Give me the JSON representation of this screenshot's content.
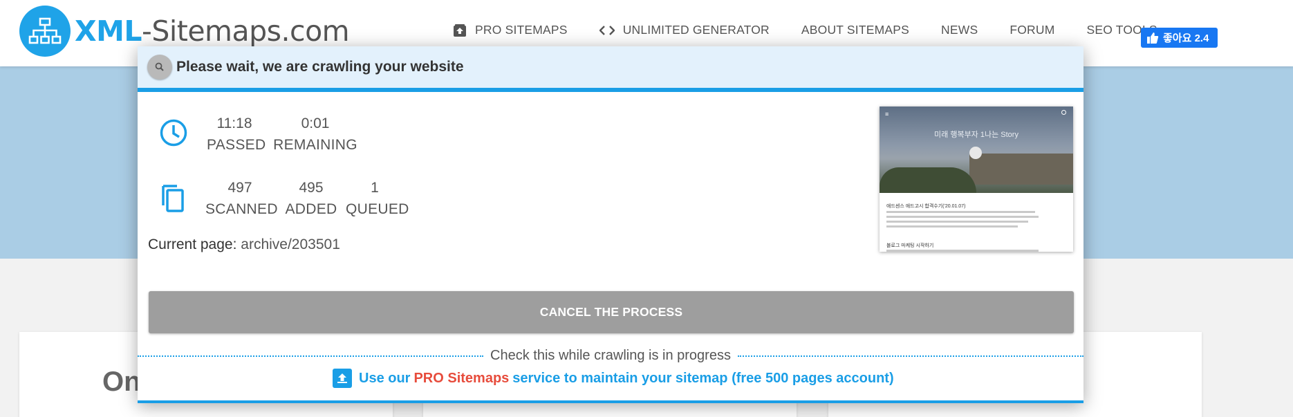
{
  "header": {
    "logo_xml": "XML",
    "logo_rest": "-Sitemaps.com",
    "nav": [
      {
        "label": "PRO SITEMAPS",
        "icon": "pro-sitemaps-icon"
      },
      {
        "label": "UNLIMITED GENERATOR",
        "icon": "code-icon"
      },
      {
        "label": "ABOUT SITEMAPS"
      },
      {
        "label": "NEWS"
      },
      {
        "label": "FORUM"
      },
      {
        "label": "SEO TOOLS"
      }
    ],
    "fb_like_label": "좋아요 2.4"
  },
  "background": {
    "card_title": "On"
  },
  "modal": {
    "title": "Please wait, we are crawling your website",
    "time": {
      "passed_value": "11:18",
      "passed_label": "PASSED",
      "remaining_value": "0:01",
      "remaining_label": "REMAINING"
    },
    "pages": {
      "scanned_value": "497",
      "scanned_label": "SCANNED",
      "added_value": "495",
      "added_label": "ADDED",
      "queued_value": "1",
      "queued_label": "QUEUED"
    },
    "current_label": "Current page:",
    "current_value": "archive/203501",
    "thumbnail": {
      "site_title": "미래 행복부자 1나는 Story",
      "post1_title": "애드센스 애드고시 합격수기('20.01.07)",
      "post2_title": "블로그 마케팅 시작하기"
    },
    "cancel_label": "CANCEL THE PROCESS",
    "check_text": "Check this while crawling is in progress",
    "promo_prefix": "Use our",
    "promo_pro": "PRO Sitemaps",
    "promo_suffix": "service to maintain your sitemap (free 500 pages account)"
  },
  "colors": {
    "accent": "#1a9ee6",
    "promo_red": "#e74c3c",
    "cancel_gray": "#9e9e9e",
    "header_bg": "#e3f1fc"
  }
}
